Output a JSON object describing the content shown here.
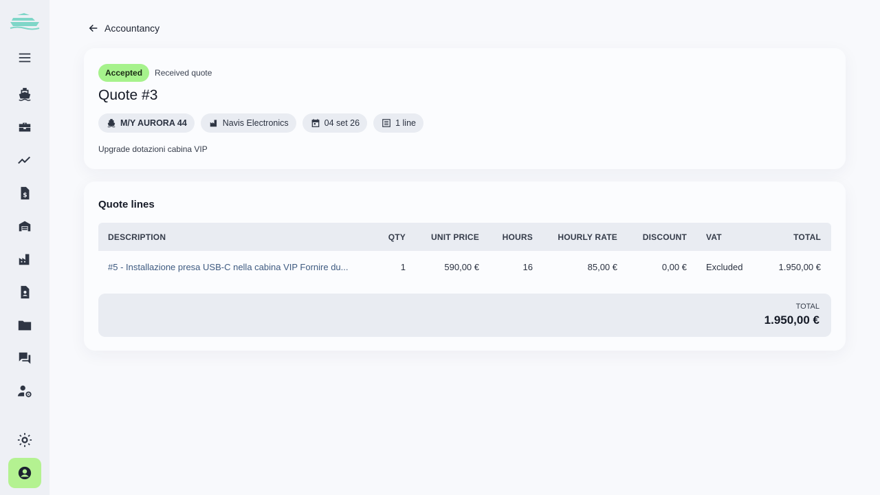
{
  "colors": {
    "accent": "#b4f291",
    "accepted_badge": "#a6f28c",
    "logo": "#7fd6c8",
    "icon": "#2f3644"
  },
  "sidebar": {
    "logo_icon": "yacht-logo-icon",
    "items": [
      {
        "name": "menu",
        "icon": "hamburger-icon"
      },
      {
        "name": "fleet",
        "icon": "ship-icon"
      },
      {
        "name": "services",
        "icon": "toolbox-icon"
      },
      {
        "name": "analytics",
        "icon": "trending-icon"
      },
      {
        "name": "invoices",
        "icon": "invoice-icon"
      },
      {
        "name": "warehouse",
        "icon": "warehouse-icon"
      },
      {
        "name": "suppliers",
        "icon": "factory-icon"
      },
      {
        "name": "crew",
        "icon": "person-file-icon"
      },
      {
        "name": "documents",
        "icon": "folder-icon"
      },
      {
        "name": "messages",
        "icon": "chat-icon"
      },
      {
        "name": "admin",
        "icon": "user-gear-icon"
      },
      {
        "name": "theme",
        "icon": "sun-icon"
      },
      {
        "name": "account",
        "icon": "account-circle-icon",
        "active": true
      }
    ]
  },
  "breadcrumb": {
    "back_label": "Accountancy"
  },
  "quote": {
    "status": "Accepted",
    "status_subtitle": "Received quote",
    "title": "Quote #3",
    "chips": {
      "vessel": "M/Y AURORA 44",
      "supplier": "Navis Electronics",
      "date": "04 set 26",
      "lines": "1 line"
    },
    "description": "Upgrade dotazioni cabina VIP"
  },
  "lines": {
    "title": "Quote lines",
    "columns": [
      "DESCRIPTION",
      "QTY",
      "UNIT PRICE",
      "HOURS",
      "HOURLY RATE",
      "DISCOUNT",
      "VAT",
      "TOTAL"
    ],
    "rows": [
      {
        "description": "#5 - Installazione presa USB-C nella cabina VIP Fornire du...",
        "qty": "1",
        "unit_price": "590,00 €",
        "hours": "16",
        "hourly_rate": "85,00 €",
        "discount": "0,00 €",
        "vat": "Excluded",
        "total": "1.950,00 €"
      }
    ],
    "total_label": "TOTAL",
    "total_value": "1.950,00 €"
  }
}
